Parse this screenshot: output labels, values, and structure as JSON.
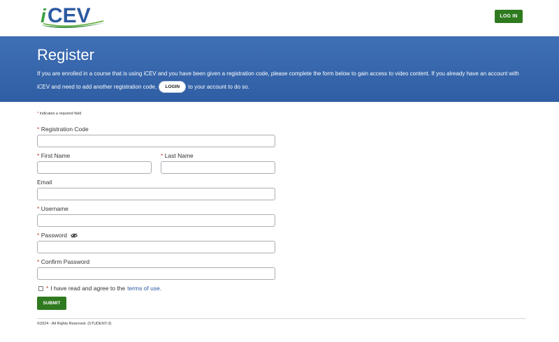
{
  "header": {
    "logo_text": "iCEV",
    "login_button": "LOG IN"
  },
  "banner": {
    "title": "Register",
    "text_part1": "If you are enrolled in a course that is using iCEV and you have been given a registration code, please complete the form below to gain access to video content. If you already have an account with iCEV and need to add another registration code,",
    "login_pill": "LOGIN",
    "text_part2": "to your account to do so."
  },
  "form": {
    "required_star": "*",
    "required_note": "indicates a required field",
    "registration_code_label": "Registration Code",
    "first_name_label": "First Name",
    "last_name_label": "Last Name",
    "email_label": "Email",
    "username_label": "Username",
    "password_label": "Password",
    "confirm_password_label": "Confirm Password",
    "registration_code_value": "",
    "first_name_value": "",
    "last_name_value": "",
    "email_value": "",
    "username_value": "",
    "password_value": "",
    "confirm_password_value": "",
    "agree_text": "I have read and agree to the",
    "terms_link": "terms of use",
    "terms_period": ".",
    "submit_button": "SUBMIT"
  },
  "footer": {
    "text": "©2024 - All Rights Reserved. (STUDENT-3)"
  },
  "colors": {
    "brand_green": "#2f7a1f",
    "banner_blue": "#3a68ae",
    "required_red": "#c0392b",
    "link_blue": "#2b5aa3"
  }
}
